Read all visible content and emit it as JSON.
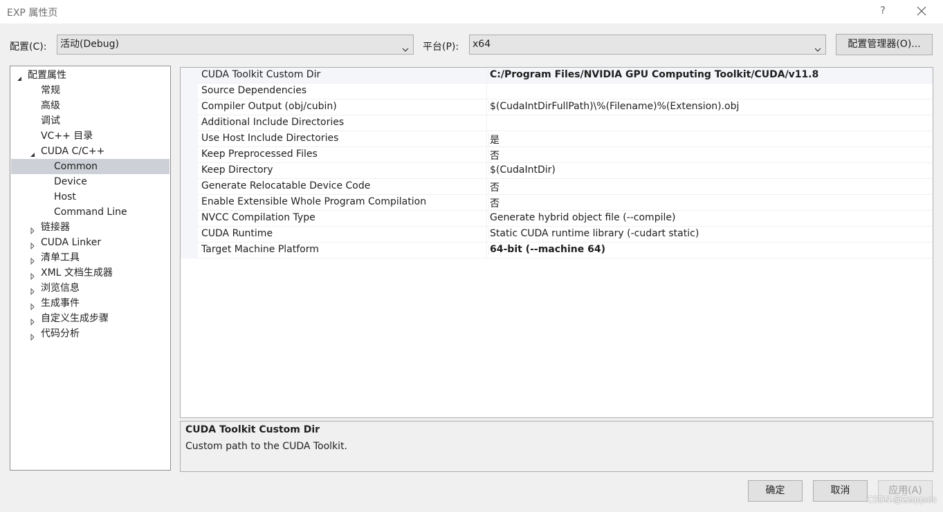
{
  "window": {
    "title": "EXP 属性页",
    "help_label": "?"
  },
  "config": {
    "config_label": "配置(C):",
    "config_value": "活动(Debug)",
    "platform_label": "平台(P):",
    "platform_value": "x64",
    "manager_button": "配置管理器(O)..."
  },
  "tree": {
    "items": [
      {
        "label": "配置属性",
        "expander": "expanded"
      },
      {
        "label": "常规",
        "expander": "none"
      },
      {
        "label": "高级",
        "expander": "none"
      },
      {
        "label": "调试",
        "expander": "none"
      },
      {
        "label": "VC++ 目录",
        "expander": "none"
      },
      {
        "label": "CUDA C/C++",
        "expander": "expanded"
      },
      {
        "label": "Common",
        "expander": "none",
        "selected": true
      },
      {
        "label": "Device",
        "expander": "none"
      },
      {
        "label": "Host",
        "expander": "none"
      },
      {
        "label": "Command Line",
        "expander": "none"
      },
      {
        "label": "链接器",
        "expander": "collapsed"
      },
      {
        "label": "CUDA Linker",
        "expander": "collapsed"
      },
      {
        "label": "清单工具",
        "expander": "collapsed"
      },
      {
        "label": "XML 文档生成器",
        "expander": "collapsed"
      },
      {
        "label": "浏览信息",
        "expander": "collapsed"
      },
      {
        "label": "生成事件",
        "expander": "collapsed"
      },
      {
        "label": "自定义生成步骤",
        "expander": "collapsed"
      },
      {
        "label": "代码分析",
        "expander": "collapsed"
      }
    ]
  },
  "properties": [
    {
      "name": "CUDA Toolkit Custom Dir",
      "value": "C:/Program Files/NVIDIA GPU Computing Toolkit/CUDA/v11.8",
      "bold": true
    },
    {
      "name": "Source Dependencies",
      "value": "",
      "bold": false
    },
    {
      "name": "Compiler Output (obj/cubin)",
      "value": "$(CudaIntDirFullPath)\\%(Filename)%(Extension).obj",
      "bold": false
    },
    {
      "name": "Additional Include Directories",
      "value": "",
      "bold": false
    },
    {
      "name": "Use Host Include Directories",
      "value": "是",
      "bold": false
    },
    {
      "name": "Keep Preprocessed Files",
      "value": "否",
      "bold": false
    },
    {
      "name": "Keep Directory",
      "value": "$(CudaIntDir)",
      "bold": false
    },
    {
      "name": "Generate Relocatable Device Code",
      "value": "否",
      "bold": false
    },
    {
      "name": "Enable Extensible Whole Program Compilation",
      "value": "否",
      "bold": false
    },
    {
      "name": "NVCC Compilation Type",
      "value": "Generate hybrid object file (--compile)",
      "bold": false
    },
    {
      "name": "CUDA Runtime",
      "value": "Static CUDA runtime library (-cudart static)",
      "bold": false
    },
    {
      "name": "Target Machine Platform",
      "value": "64-bit (--machine 64)",
      "bold": true
    }
  ],
  "description": {
    "title": "CUDA Toolkit Custom Dir",
    "text": "Custom path to the CUDA Toolkit."
  },
  "buttons": {
    "ok": "确定",
    "cancel": "取消",
    "apply": "应用(A)"
  },
  "watermark": "CSDN @Zzqqads",
  "colors": {
    "selection": "#cdd0d6",
    "disabled_text": "#a0a0a0"
  }
}
